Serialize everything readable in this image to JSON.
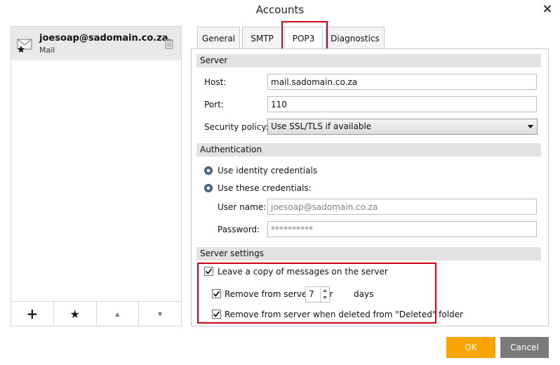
{
  "window": {
    "title": "Accounts",
    "close_glyph": "×"
  },
  "account": {
    "email": "joesoap@sadomain.co.za",
    "type": "Mail"
  },
  "panel_buttons": {
    "add": "+",
    "default": "★",
    "up": "▲",
    "down": "▼"
  },
  "tabs": [
    {
      "label": "General"
    },
    {
      "label": "SMTP"
    },
    {
      "label": "POP3"
    },
    {
      "label": "Diagnostics"
    }
  ],
  "server": {
    "header": "Server",
    "host_label": "Host:",
    "host_value": "mail.sadomain.co.za",
    "port_label": "Port:",
    "port_value": "110",
    "security_label": "Security policy:",
    "security_value": "Use SSL/TLS if available"
  },
  "authentication": {
    "header": "Authentication",
    "option_identity": "Use identity credentials",
    "option_these": "Use these credentials:",
    "username_label": "User name:",
    "username_value": "joesoap@sadomain.co.za",
    "password_label": "Password:",
    "password_value": "**********"
  },
  "server_settings": {
    "header": "Server settings",
    "leave_copy": "Leave a copy of messages on the server",
    "leave_copy_checked": true,
    "remove_after": "Remove from server after",
    "remove_after_days": "7",
    "days_label": "days",
    "remove_after_checked": true,
    "remove_deleted": "Remove from server when deleted from \"Deleted\" folder",
    "remove_deleted_checked": true
  },
  "buttons": {
    "ok": "OK",
    "cancel": "Cancel"
  },
  "colors": {
    "ok": "#f7a400",
    "cancel": "#7b7b7b",
    "highlight": "#d0021b"
  }
}
